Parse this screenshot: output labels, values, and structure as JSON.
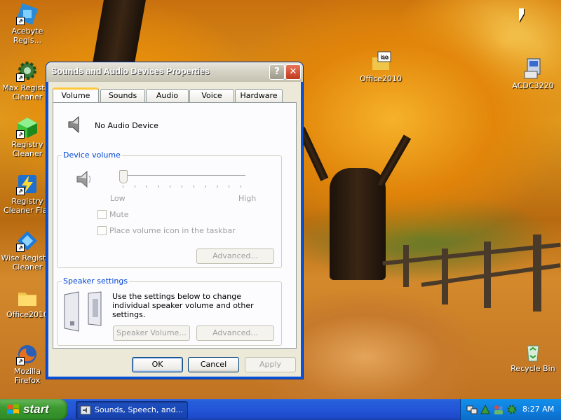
{
  "desktop": {
    "icons": [
      {
        "label": "Acebyte Regis...",
        "name": "acebyte-registry"
      },
      {
        "label": "Max Registry Cleaner",
        "name": "max-registry-cleaner"
      },
      {
        "label": "Registry Cleaner",
        "name": "registry-cleaner"
      },
      {
        "label": "Registry Cleaner Flas",
        "name": "registry-cleaner-flash"
      },
      {
        "label": "Wise Registry Cleaner",
        "name": "wise-registry-cleaner"
      },
      {
        "label": "Office2010",
        "name": "office2010-folder"
      },
      {
        "label": "Mozilla Firefox",
        "name": "mozilla-firefox"
      },
      {
        "label": "Office2010",
        "name": "office2010-iso"
      },
      {
        "label": "ACDC3220",
        "name": "acdc3220"
      },
      {
        "label": "Recycle Bin",
        "name": "recycle-bin"
      }
    ]
  },
  "window": {
    "title": "Sounds and Audio Devices Properties",
    "help_label": "?",
    "close_label": "✕",
    "tabs": [
      "Volume",
      "Sounds",
      "Audio",
      "Voice",
      "Hardware"
    ],
    "active_tab": "Volume",
    "device_name": "No Audio Device",
    "device_volume": {
      "label": "Device volume",
      "low": "Low",
      "high": "High",
      "level": 0,
      "mute_label": "Mute",
      "taskbar_icon_label": "Place volume icon in the taskbar",
      "advanced_label": "Advanced..."
    },
    "speaker_settings": {
      "label": "Speaker settings",
      "description": "Use the settings below to change individual speaker volume and other settings.",
      "speaker_volume_label": "Speaker Volume...",
      "advanced_label": "Advanced..."
    },
    "buttons": {
      "ok": "OK",
      "cancel": "Cancel",
      "apply": "Apply"
    }
  },
  "taskbar": {
    "start_label": "start",
    "task_label": "Sounds, Speech, and...",
    "clock": "8:27 AM"
  }
}
